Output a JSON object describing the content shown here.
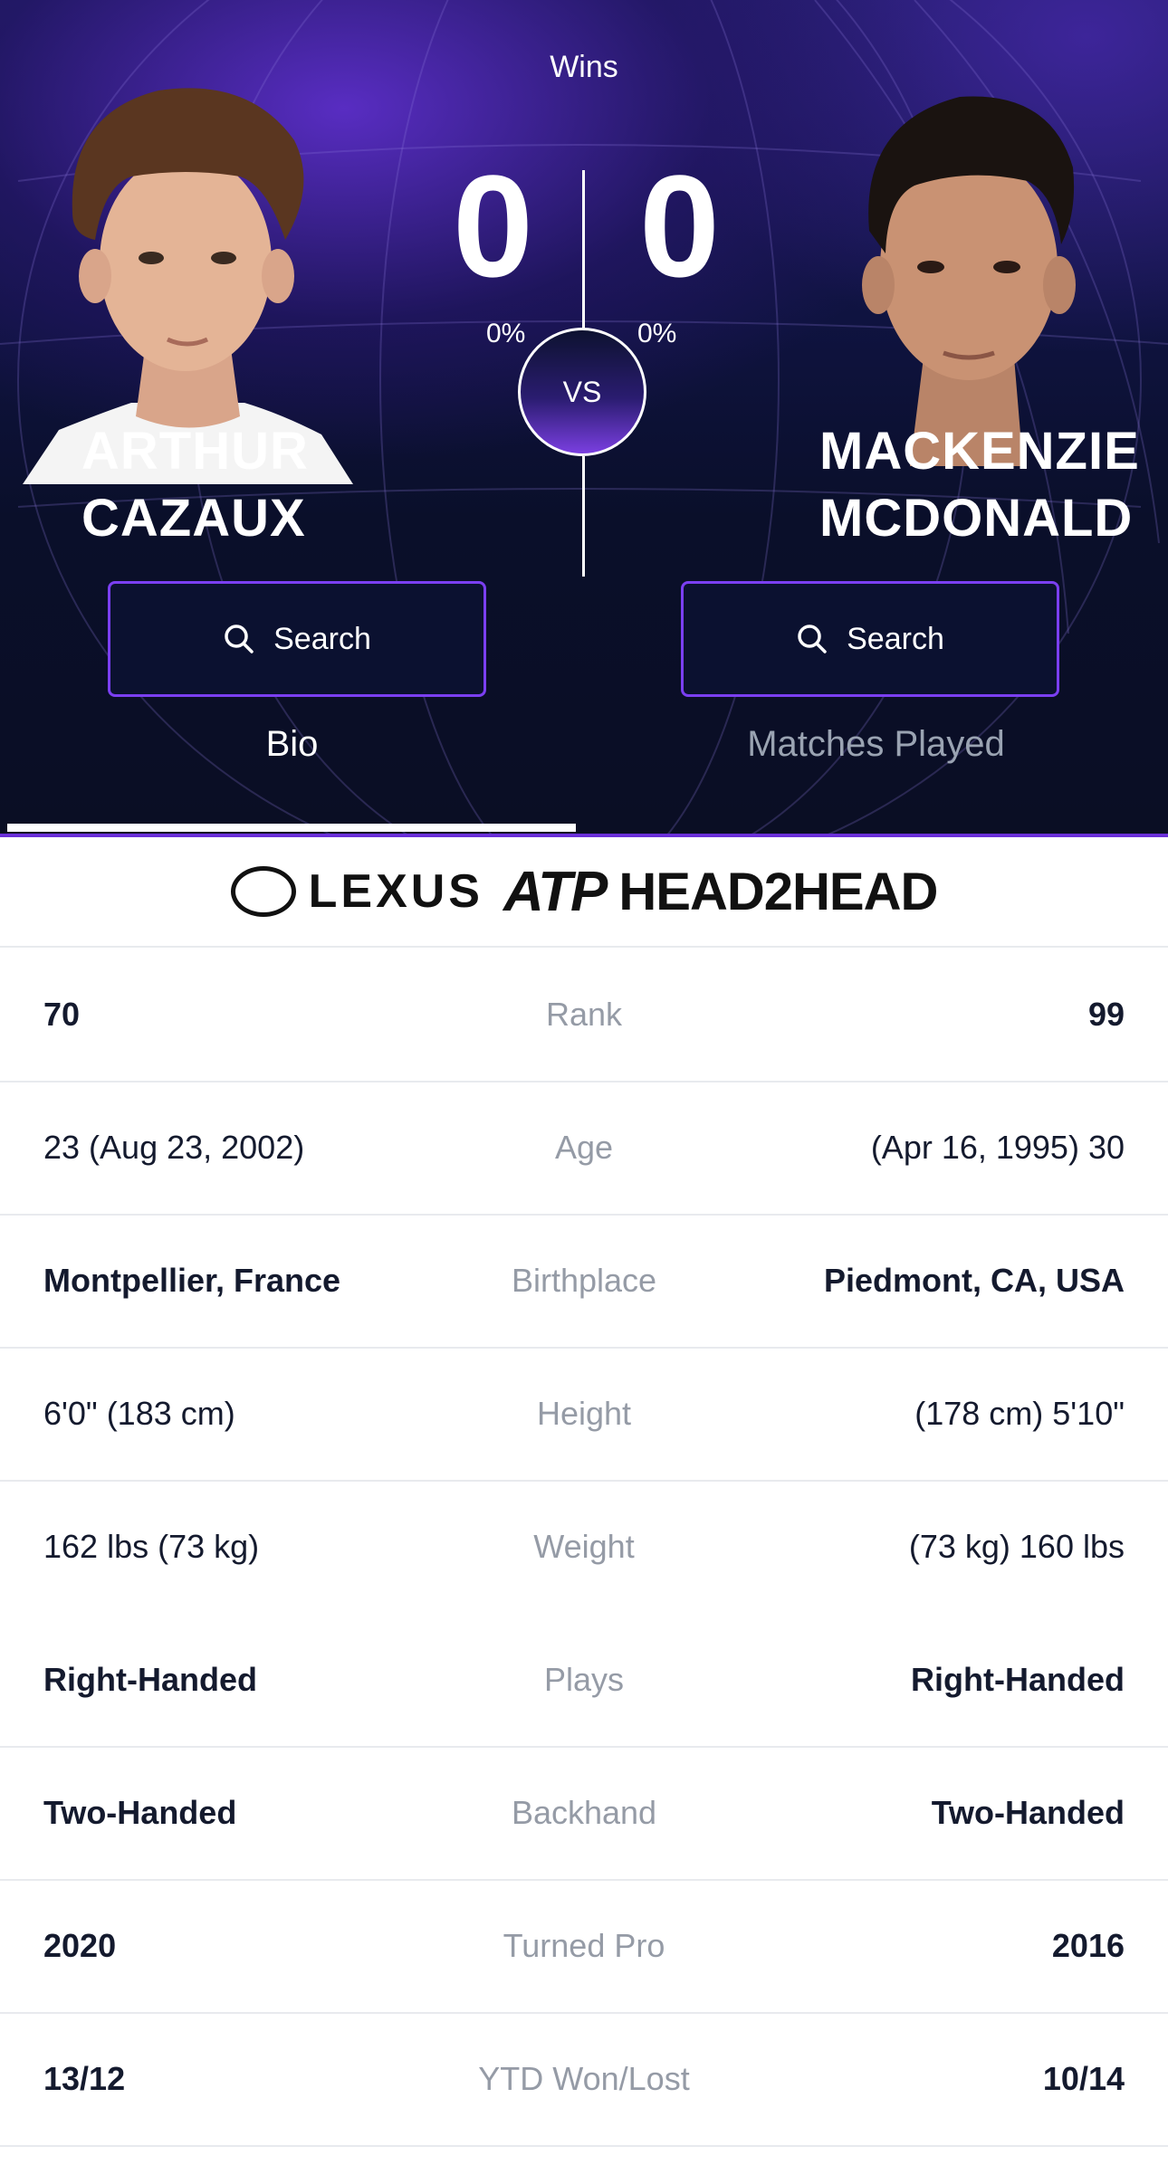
{
  "header": {
    "wins_label": "Wins"
  },
  "player1": {
    "first_name": "ARTHUR",
    "last_name": "CAZAUX",
    "wins": "0",
    "win_pct": "0%"
  },
  "player2": {
    "first_name": "MACKENZIE",
    "last_name": "MCDONALD",
    "wins": "0",
    "win_pct": "0%"
  },
  "vs_label": "VS",
  "search": {
    "left_label": "Search",
    "right_label": "Search"
  },
  "tabs": [
    {
      "label": "Bio",
      "active": true
    },
    {
      "label": "Matches Played",
      "active": false
    }
  ],
  "logo": {
    "brand1": "LEXUS",
    "brand2": "ATP",
    "title": "HEAD2HEAD"
  },
  "bio_rows": [
    {
      "left": "70",
      "label": "Rank",
      "right": "99",
      "bold": true
    },
    {
      "left": "23 (Aug 23, 2002)",
      "label": "Age",
      "right": "(Apr 16, 1995) 30",
      "bold": false
    },
    {
      "left": "Montpellier, France",
      "label": "Birthplace",
      "right": "Piedmont, CA, USA",
      "bold": true
    },
    {
      "left": "6'0\" (183 cm)",
      "label": "Height",
      "right": "(178 cm) 5'10\"",
      "bold": false
    },
    {
      "left": "162 lbs (73 kg)",
      "label": "Weight",
      "right": "(73 kg) 160 lbs",
      "bold": false
    },
    {
      "left": "Right-Handed",
      "label": "Plays",
      "right": "Right-Handed",
      "bold": true
    },
    {
      "left": "Two-Handed",
      "label": "Backhand",
      "right": "Two-Handed",
      "bold": true
    },
    {
      "left": "2020",
      "label": "Turned Pro",
      "right": "2016",
      "bold": true
    },
    {
      "left": "13/12",
      "label": "YTD Won/Lost",
      "right": "10/14",
      "bold": true
    }
  ],
  "colors": {
    "accent": "#7b3ff2",
    "hero_bg": "#0a0e24",
    "label_gray": "#959ba6",
    "value_text": "#141a2e"
  }
}
